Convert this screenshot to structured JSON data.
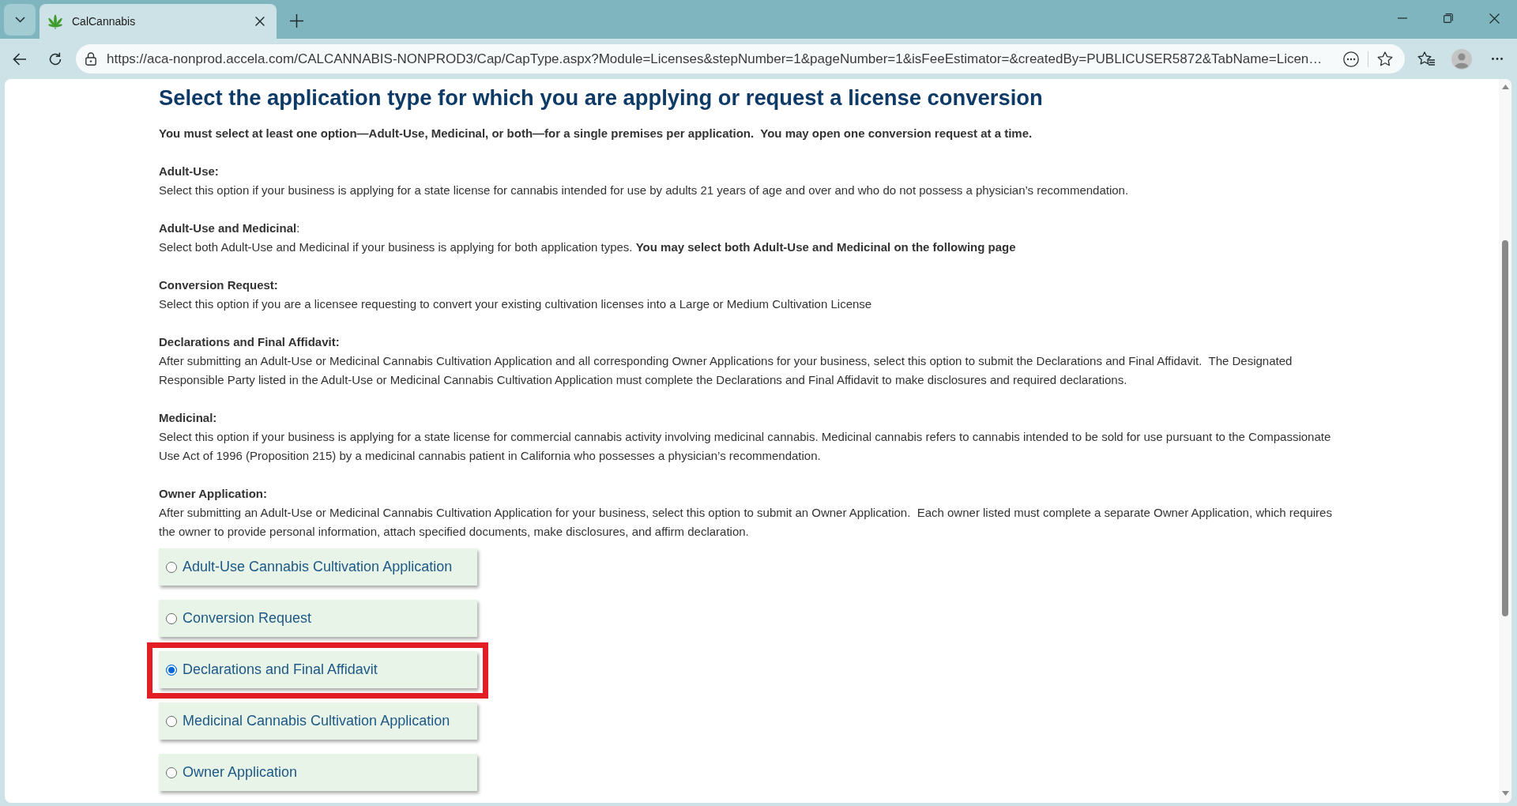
{
  "browser": {
    "tabs": [
      {
        "title": "CalCannabis",
        "selected": true
      }
    ],
    "address": "https://aca-nonprod.accela.com/CALCANNABIS-NONPROD3/Cap/CapType.aspx?Module=Licenses&stepNumber=1&pageNumber=1&isFeeEstimator=&createdBy=PUBLICUSER5872&TabName=Licen…"
  },
  "page": {
    "heading": "Select the application type for which you are applying or request a license conversion",
    "intro": "You must select at least one option—Adult-Use, Medicinal, or both—for a single premises per application.  You may open one conversion request at a time.",
    "sections": [
      {
        "kind": "bold",
        "title": "Adult-Use:",
        "text": "Select this option if your business is applying for a state license for cannabis intended for use by adults 21 years of age and over and who do not possess a physician’s recommendation."
      },
      {
        "kind": "mixed",
        "title": "**Adult-Use and Medicinal**:",
        "text": "Select both Adult-Use and Medicinal if your business is applying for both application types. **You may select both Adult-Use and Medicinal on the following page**"
      },
      {
        "kind": "bold",
        "title": "Conversion Request:",
        "text": "Select this option if you are a licensee requesting to convert your existing cultivation licenses into a Large or Medium Cultivation License"
      },
      {
        "kind": "bold",
        "title": "Declarations and Final Affidavit:",
        "text": "After submitting an Adult-Use or Medicinal Cannabis Cultivation Application and all corresponding Owner Applications for your business, select this option to submit the Declarations and Final Affidavit.  The Designated Responsible Party listed in the Adult-Use or Medicinal Cannabis Cultivation Application must complete the Declarations and Final Affidavit to make disclosures and required declarations."
      },
      {
        "kind": "bold",
        "title": "Medicinal:",
        "text": "Select this option if your business is applying for a state license for commercial cannabis activity involving medicinal cannabis. Medicinal cannabis refers to cannabis intended to be sold for use pursuant to the Compassionate Use Act of 1996 (Proposition 215) by a medicinal cannabis patient in California who possesses a physician’s recommendation."
      },
      {
        "kind": "bold",
        "title": "Owner Application:",
        "text": "After submitting an Adult-Use or Medicinal Cannabis Cultivation Application for your business, select this option to submit an Owner Application.  Each owner listed must complete a separate Owner Application, which requires the owner to provide personal information, attach specified documents, make disclosures, and affirm declaration."
      }
    ],
    "options": [
      {
        "label": "Adult-Use Cannabis Cultivation Application",
        "selected": false,
        "highlighted": false
      },
      {
        "label": "Conversion Request",
        "selected": false,
        "highlighted": false
      },
      {
        "label": "Declarations and Final Affidavit",
        "selected": true,
        "highlighted": true
      },
      {
        "label": "Medicinal Cannabis Cultivation Application",
        "selected": false,
        "highlighted": false
      },
      {
        "label": "Owner Application",
        "selected": false,
        "highlighted": false
      }
    ]
  }
}
